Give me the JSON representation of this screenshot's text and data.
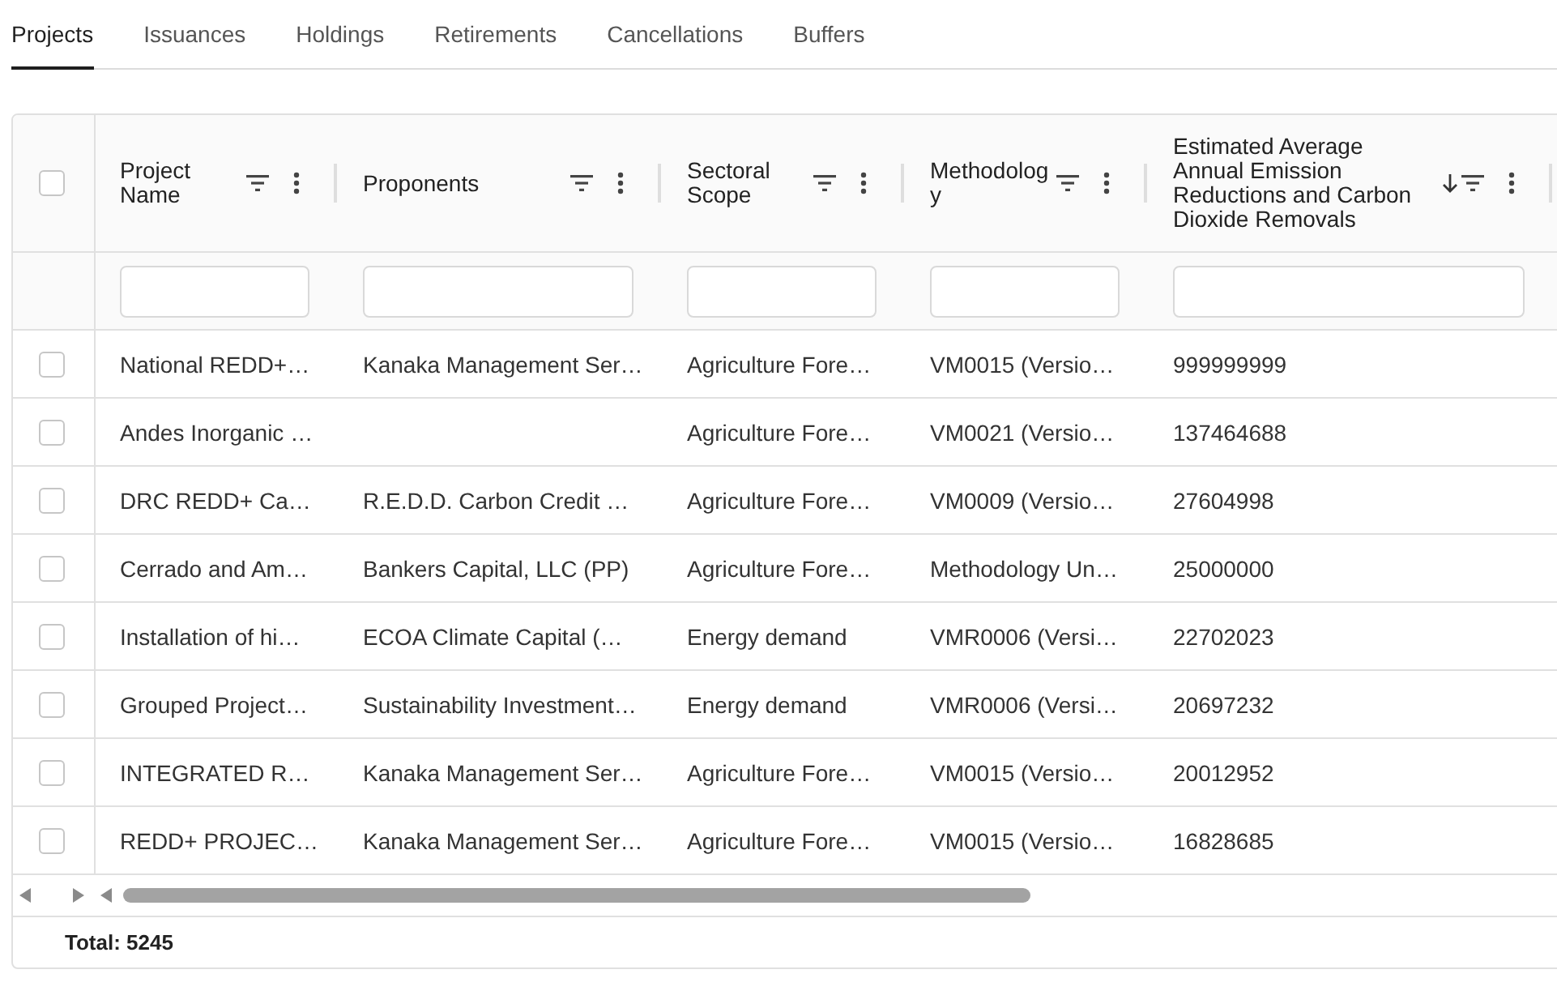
{
  "tabs": [
    {
      "label": "Projects",
      "selected": true
    },
    {
      "label": "Issuances",
      "selected": false
    },
    {
      "label": "Holdings",
      "selected": false
    },
    {
      "label": "Retirements",
      "selected": false
    },
    {
      "label": "Cancellations",
      "selected": false
    },
    {
      "label": "Buffers",
      "selected": false
    }
  ],
  "table": {
    "select_all": {
      "checked": false
    },
    "columns": [
      {
        "label": "Project Name",
        "sorted_descending": false
      },
      {
        "label": "Proponents",
        "sorted_descending": false
      },
      {
        "label": "Sectoral Scope",
        "sorted_descending": false
      },
      {
        "label": "Methodology",
        "sorted_descending": false
      },
      {
        "label": "Estimated Average Annual Emission Reductions and Carbon Dioxide Removals",
        "sorted_descending": true
      }
    ],
    "rows": [
      {
        "checked": false,
        "cells": [
          "National REDD+…",
          "Kanaka Management Ser…",
          "Agriculture Fore…",
          "VM0015 (Versio…",
          "999999999"
        ]
      },
      {
        "checked": false,
        "cells": [
          "Andes Inorganic …",
          null,
          "Agriculture Fore…",
          "VM0021 (Versio…",
          "137464688"
        ]
      },
      {
        "checked": false,
        "cells": [
          "DRC REDD+ Ca…",
          "R.E.D.D. Carbon Credit …",
          "Agriculture Fore…",
          "VM0009 (Versio…",
          "27604998"
        ]
      },
      {
        "checked": false,
        "cells": [
          "Cerrado and Am…",
          "Bankers Capital, LLC (PP)",
          "Agriculture Fore…",
          "Methodology Un…",
          "25000000"
        ]
      },
      {
        "checked": false,
        "cells": [
          "Installation of hi…",
          "ECOA Climate Capital (…",
          "Energy demand",
          "VMR0006 (Versi…",
          "22702023"
        ]
      },
      {
        "checked": false,
        "cells": [
          "Grouped Project…",
          "Sustainability Investment…",
          "Energy demand",
          "VMR0006 (Versi…",
          "20697232"
        ]
      },
      {
        "checked": false,
        "cells": [
          "INTEGRATED R…",
          "Kanaka Management Ser…",
          "Agriculture Fore…",
          "VM0015 (Versio…",
          "20012952"
        ]
      },
      {
        "checked": false,
        "cells": [
          "REDD+ PROJEC…",
          "Kanaka Management Ser…",
          "Agriculture Fore…",
          "VM0015 (Versio…",
          "16828685"
        ]
      }
    ],
    "total": "Total: 5245"
  }
}
